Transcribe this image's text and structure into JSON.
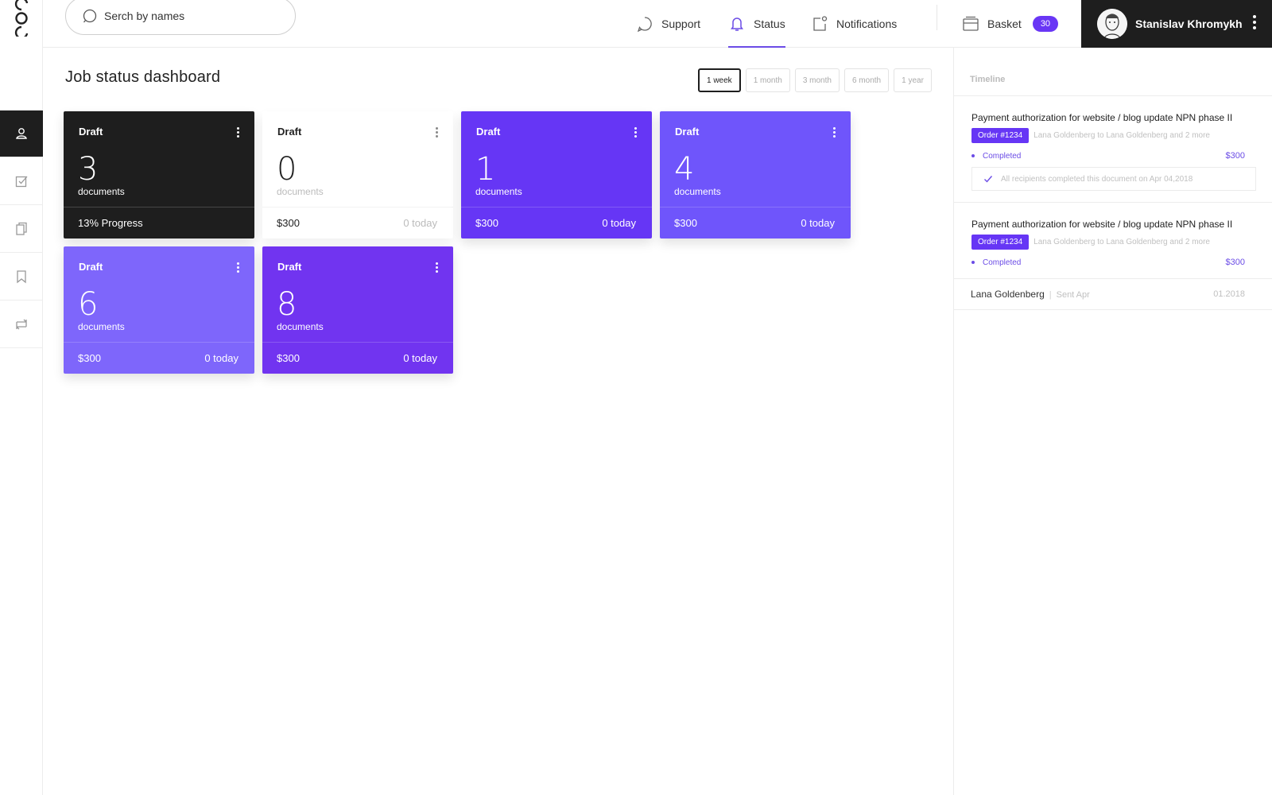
{
  "header": {
    "search_placeholder": "Serch by names",
    "nav": [
      {
        "label": "Support"
      },
      {
        "label": "Status"
      },
      {
        "label": "Notifications"
      },
      {
        "label": "Basket",
        "badge": "30"
      }
    ],
    "user_name": "Stanislav Khromykh"
  },
  "main": {
    "title": "Job status dashboard",
    "ranges": [
      "1 week",
      "1 month",
      "3 month",
      "6 month",
      "1 year"
    ],
    "cards": [
      {
        "title": "Draft",
        "count": "3",
        "unit": "documents",
        "foot_left": "13% Progress",
        "foot_right": ""
      },
      {
        "title": "Draft",
        "count": "0",
        "unit": "documents",
        "foot_left": "$300",
        "foot_right": "0 today"
      },
      {
        "title": "Draft",
        "count": "1",
        "unit": "documents",
        "foot_left": "$300",
        "foot_right": "0 today"
      },
      {
        "title": "Draft",
        "count": "4",
        "unit": "documents",
        "foot_left": "$300",
        "foot_right": "0 today"
      },
      {
        "title": "Draft",
        "count": "6",
        "unit": "documents",
        "foot_left": "$300",
        "foot_right": "0 today"
      },
      {
        "title": "Draft",
        "count": "8",
        "unit": "documents",
        "foot_left": "$300",
        "foot_right": "0 today"
      }
    ]
  },
  "timeline": {
    "heading": "Timeline",
    "entries": [
      {
        "title": "Payment authorization for website / blog update NPN phase II",
        "order": "Order #1234",
        "sub": "Lana Goldenberg to Lana Goldenberg and 2 more",
        "status": "Completed",
        "amount": "$300",
        "note": "All recipients completed this document on Apr 04,2018"
      },
      {
        "title": "Payment authorization for website / blog update NPN phase II",
        "order": "Order #1234",
        "sub": "Lana Goldenberg to Lana Goldenberg and 2 more",
        "status": "Completed",
        "amount": "$300"
      }
    ],
    "last": {
      "name": "Lana Goldenberg",
      "sep": "|",
      "sent": "Sent Apr",
      "date": "01.2018"
    }
  },
  "colors": {
    "accent": "#6936f5",
    "dark": "#1e1e1e"
  }
}
